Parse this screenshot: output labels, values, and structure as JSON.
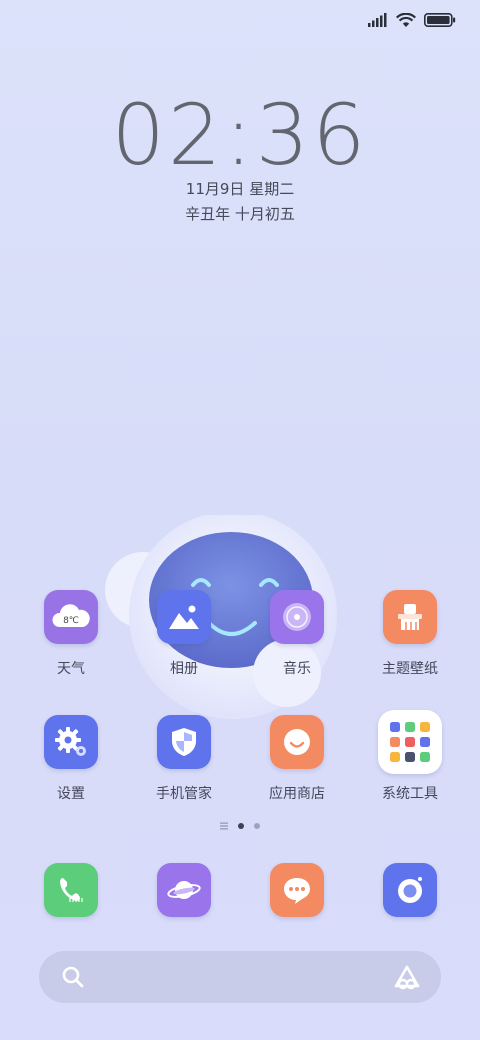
{
  "lockscreen": {
    "time": "02:36",
    "date": "11月9日 星期二",
    "lunar": "辛丑年 十月初五"
  },
  "weather_widget": {
    "temp": "8℃"
  },
  "apps_row1": [
    {
      "label": "天气",
      "icon": "weather-icon",
      "color": "#9873e6"
    },
    {
      "label": "相册",
      "icon": "gallery-icon",
      "color": "#5e73ec"
    },
    {
      "label": "音乐",
      "icon": "music-icon",
      "color": "#9a74ea"
    },
    {
      "label": "主题壁纸",
      "icon": "theme-icon",
      "color": "#f48a62"
    }
  ],
  "apps_row2": [
    {
      "label": "设置",
      "icon": "settings-icon",
      "color": "#5e73ec"
    },
    {
      "label": "手机管家",
      "icon": "security-icon",
      "color": "#5e73ec"
    },
    {
      "label": "应用商店",
      "icon": "app-store-icon",
      "color": "#f48a62"
    },
    {
      "label": "系统工具",
      "icon": "folder-icon",
      "color": "#ffffff"
    }
  ],
  "dock": [
    {
      "icon": "phone-icon",
      "color": "#5ccd7a"
    },
    {
      "icon": "browser-icon",
      "color": "#9a74ea"
    },
    {
      "icon": "messages-icon",
      "color": "#f48a62"
    },
    {
      "icon": "camera-icon",
      "color": "#5e73ec"
    }
  ],
  "page_indicator": {
    "pages": 2,
    "active": 1
  }
}
